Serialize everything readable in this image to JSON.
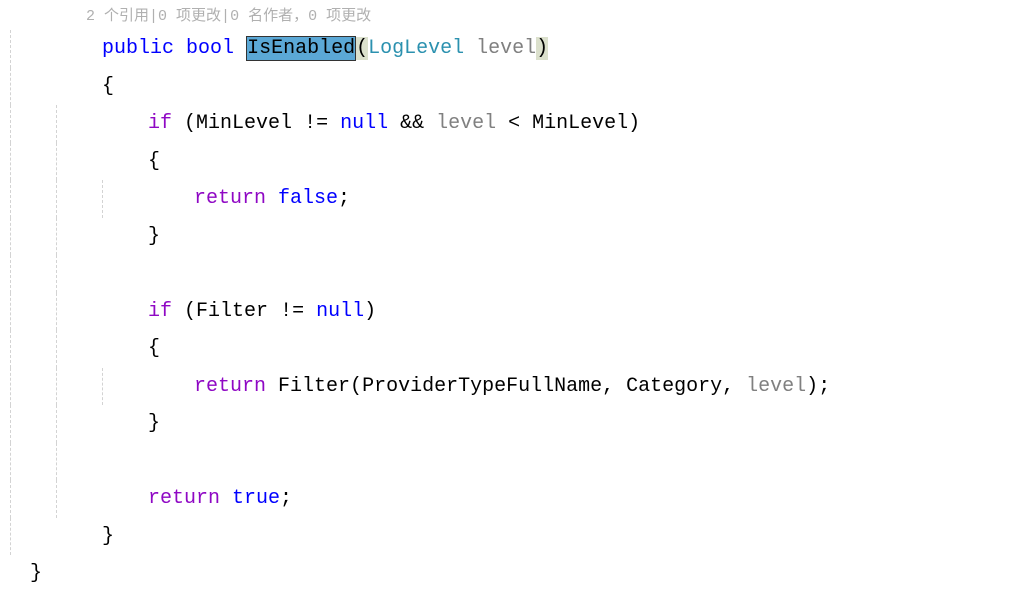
{
  "codelens": {
    "refs": "2 个引用",
    "changes1": "0 项更改",
    "authors": "0 名作者",
    "changes2": "0 项更改"
  },
  "sig": {
    "access": "public",
    "returnType": "bool",
    "methodName": "IsEnabled",
    "lparen": "(",
    "paramType": "LogLevel",
    "sp": " ",
    "paramName": "level",
    "rparen": ")"
  },
  "braces": {
    "open": "{",
    "close": "}"
  },
  "if1": {
    "kw": "if",
    "sp": " ",
    "lp": "(",
    "cond1a": "MinLevel",
    "cond1b": " != ",
    "nul": "null",
    "and": " && ",
    "lvl": "level",
    "lt": " < ",
    "cond1c": "MinLevel",
    "rp": ")"
  },
  "ret1": {
    "kw": "return",
    "sp": " ",
    "val": "false",
    "semi": ";"
  },
  "if2": {
    "kw": "if",
    "sp": " ",
    "lp": "(",
    "cond2a": "Filter",
    "cond2b": " != ",
    "nul": "null",
    "rp": ")"
  },
  "ret2": {
    "kw": "return",
    "sp": " ",
    "call": "Filter",
    "lp": "(",
    "a1": "ProviderTypeFullName",
    "c1": ", ",
    "a2": "Category",
    "c2": ", ",
    "a3": "level",
    "rp": ")",
    "semi": ";"
  },
  "ret3": {
    "kw": "return",
    "sp": " ",
    "val": "true",
    "semi": ";"
  },
  "sep": "|",
  "comma": "，"
}
